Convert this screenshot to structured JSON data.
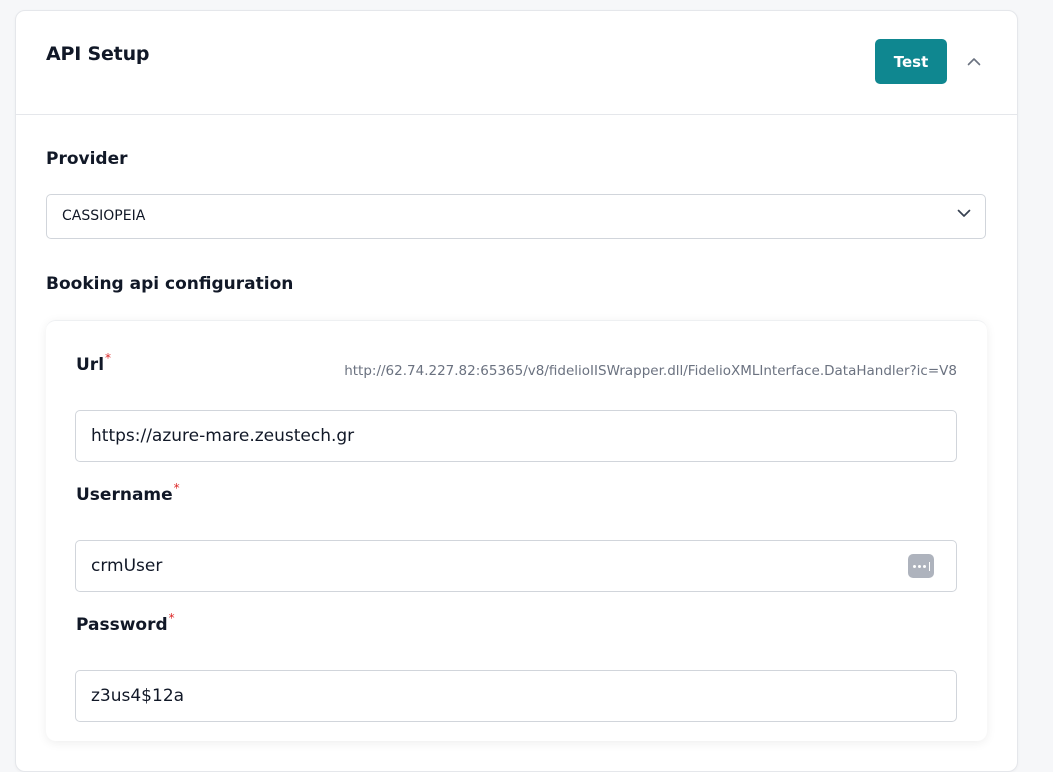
{
  "header": {
    "title": "API Setup",
    "test_label": "Test"
  },
  "provider": {
    "label": "Provider",
    "selected": "CASSIOPEIA"
  },
  "booking": {
    "section_title": "Booking api configuration",
    "required_mark": "*",
    "url": {
      "label": "Url",
      "hint": "http://62.74.227.82:65365/v8/fidelioIISWrapper.dll/FidelioXMLInterface.DataHandler?ic=V8",
      "value": "https://azure-mare.zeustech.gr"
    },
    "username": {
      "label": "Username",
      "value": "crmUser"
    },
    "password": {
      "label": "Password",
      "value": "z3us4$12a"
    }
  },
  "icons": {
    "collapse": "chevron-up-icon",
    "select": "chevron-down-icon",
    "password_manager": "password-manager-icon"
  },
  "colors": {
    "accent": "#0f8790",
    "required": "#dc2626",
    "hint_text": "#6b7280"
  }
}
